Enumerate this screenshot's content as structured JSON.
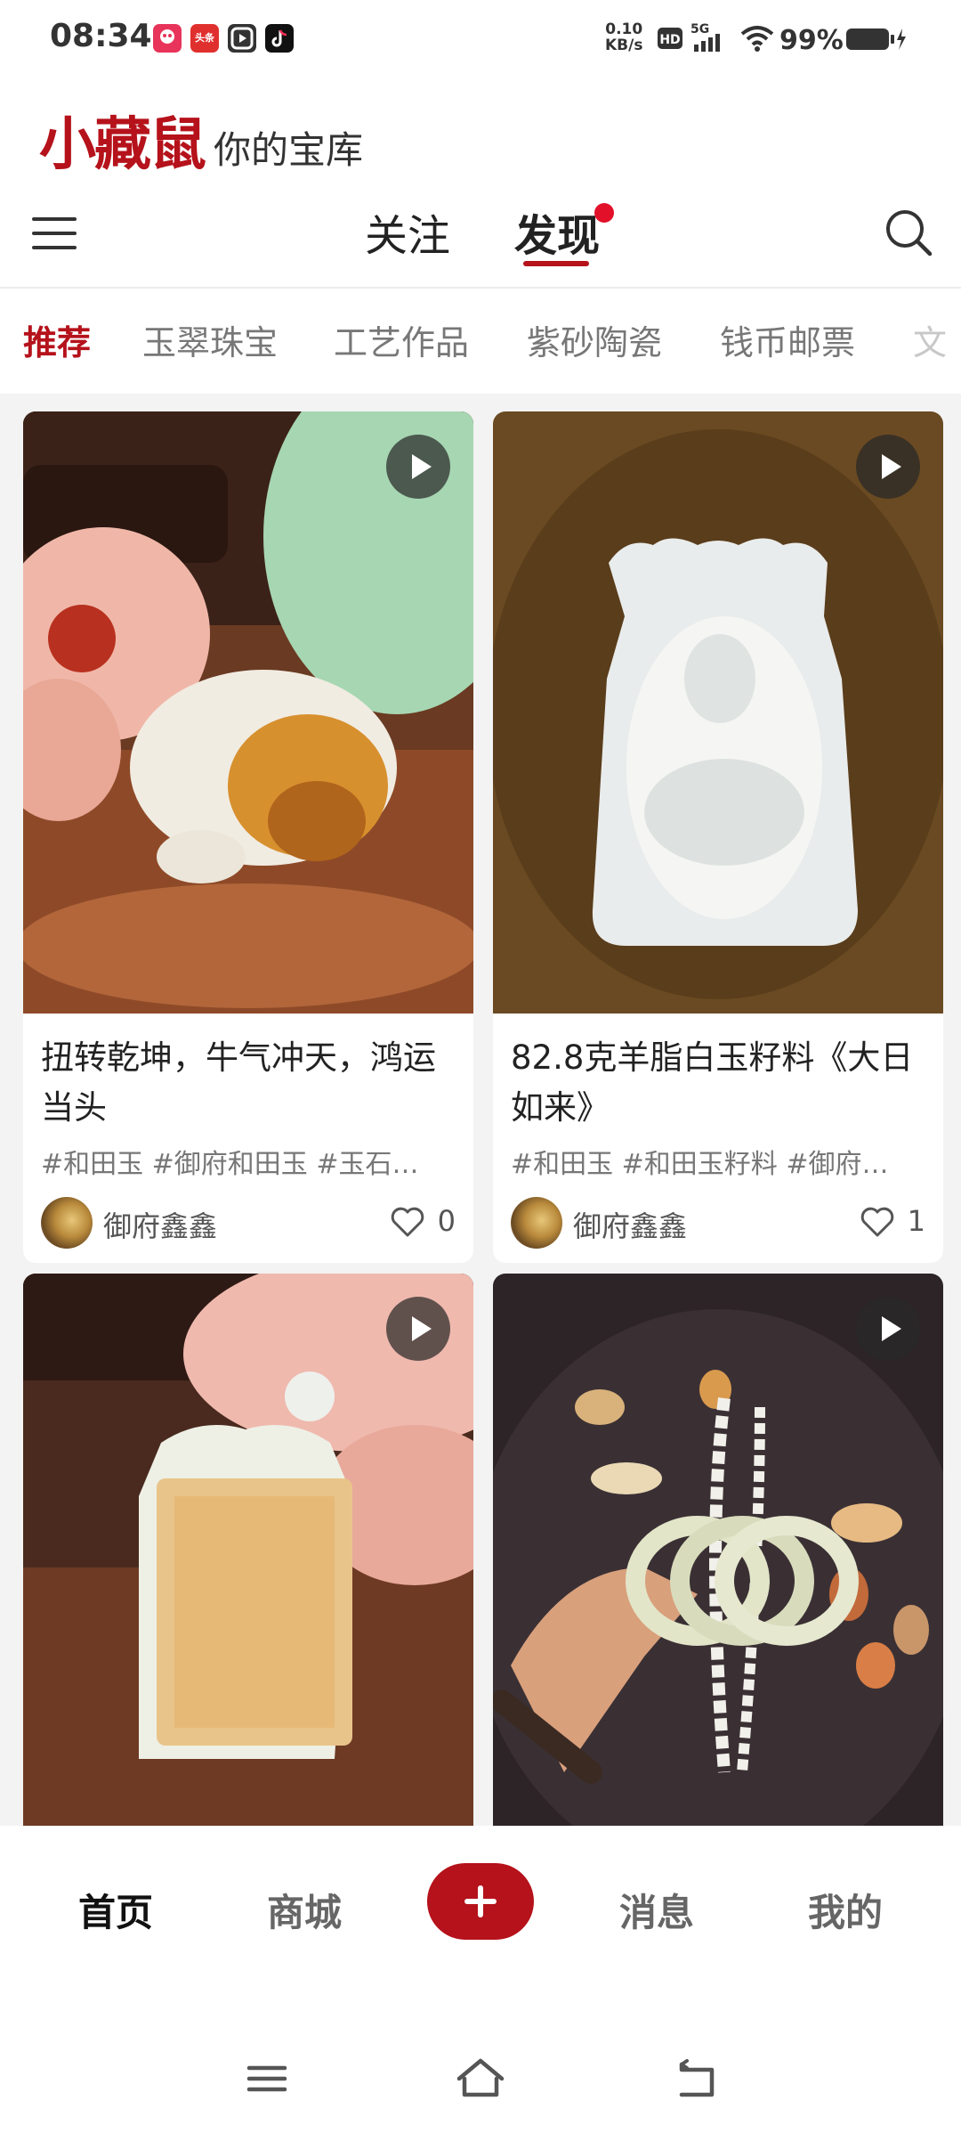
{
  "status_bar": {
    "time": "08:34",
    "app_icons": [
      "app-icon-pink",
      "toutiao-icon",
      "video-icon",
      "tiktok-icon"
    ],
    "app_icon_labels": {
      "toutiao": "头条"
    },
    "net_speed_value": "0.10",
    "net_speed_unit": "KB/s",
    "hd_label": "HD",
    "network": "5G",
    "battery": "99%"
  },
  "brand": {
    "logo": "小藏鼠",
    "slogan": "你的宝库"
  },
  "top_nav": {
    "tabs": [
      {
        "label": "关注",
        "active": false
      },
      {
        "label": "发现",
        "active": true,
        "has_dot": true
      }
    ]
  },
  "categories": [
    {
      "label": "推荐",
      "active": true
    },
    {
      "label": "玉翠珠宝",
      "active": false
    },
    {
      "label": "工艺作品",
      "active": false
    },
    {
      "label": "紫砂陶瓷",
      "active": false
    },
    {
      "label": "钱币邮票",
      "active": false
    },
    {
      "label": "文",
      "active": false
    }
  ],
  "feed": {
    "cards": [
      {
        "title": "扭转乾坤，牛气冲天，鸿运当头",
        "tags": "#和田玉 #御府和田玉 #玉石…",
        "author": "御府鑫鑫",
        "likes": "0",
        "is_video": true
      },
      {
        "title": "82.8克羊脂白玉籽料《大日如来》",
        "tags": "#和田玉 #和田玉籽料 #御府…",
        "author": "御府鑫鑫",
        "likes": "1",
        "is_video": true
      },
      {
        "is_video": true
      },
      {
        "is_video": true
      }
    ]
  },
  "bottom_nav": {
    "items": [
      {
        "label": "首页",
        "active": true
      },
      {
        "label": "商城",
        "active": false
      },
      {
        "label": "消息",
        "active": false
      },
      {
        "label": "我的",
        "active": false
      }
    ],
    "accent_color": "#b5121b"
  },
  "system_nav": [
    "menu-icon",
    "home-icon",
    "back-icon"
  ]
}
